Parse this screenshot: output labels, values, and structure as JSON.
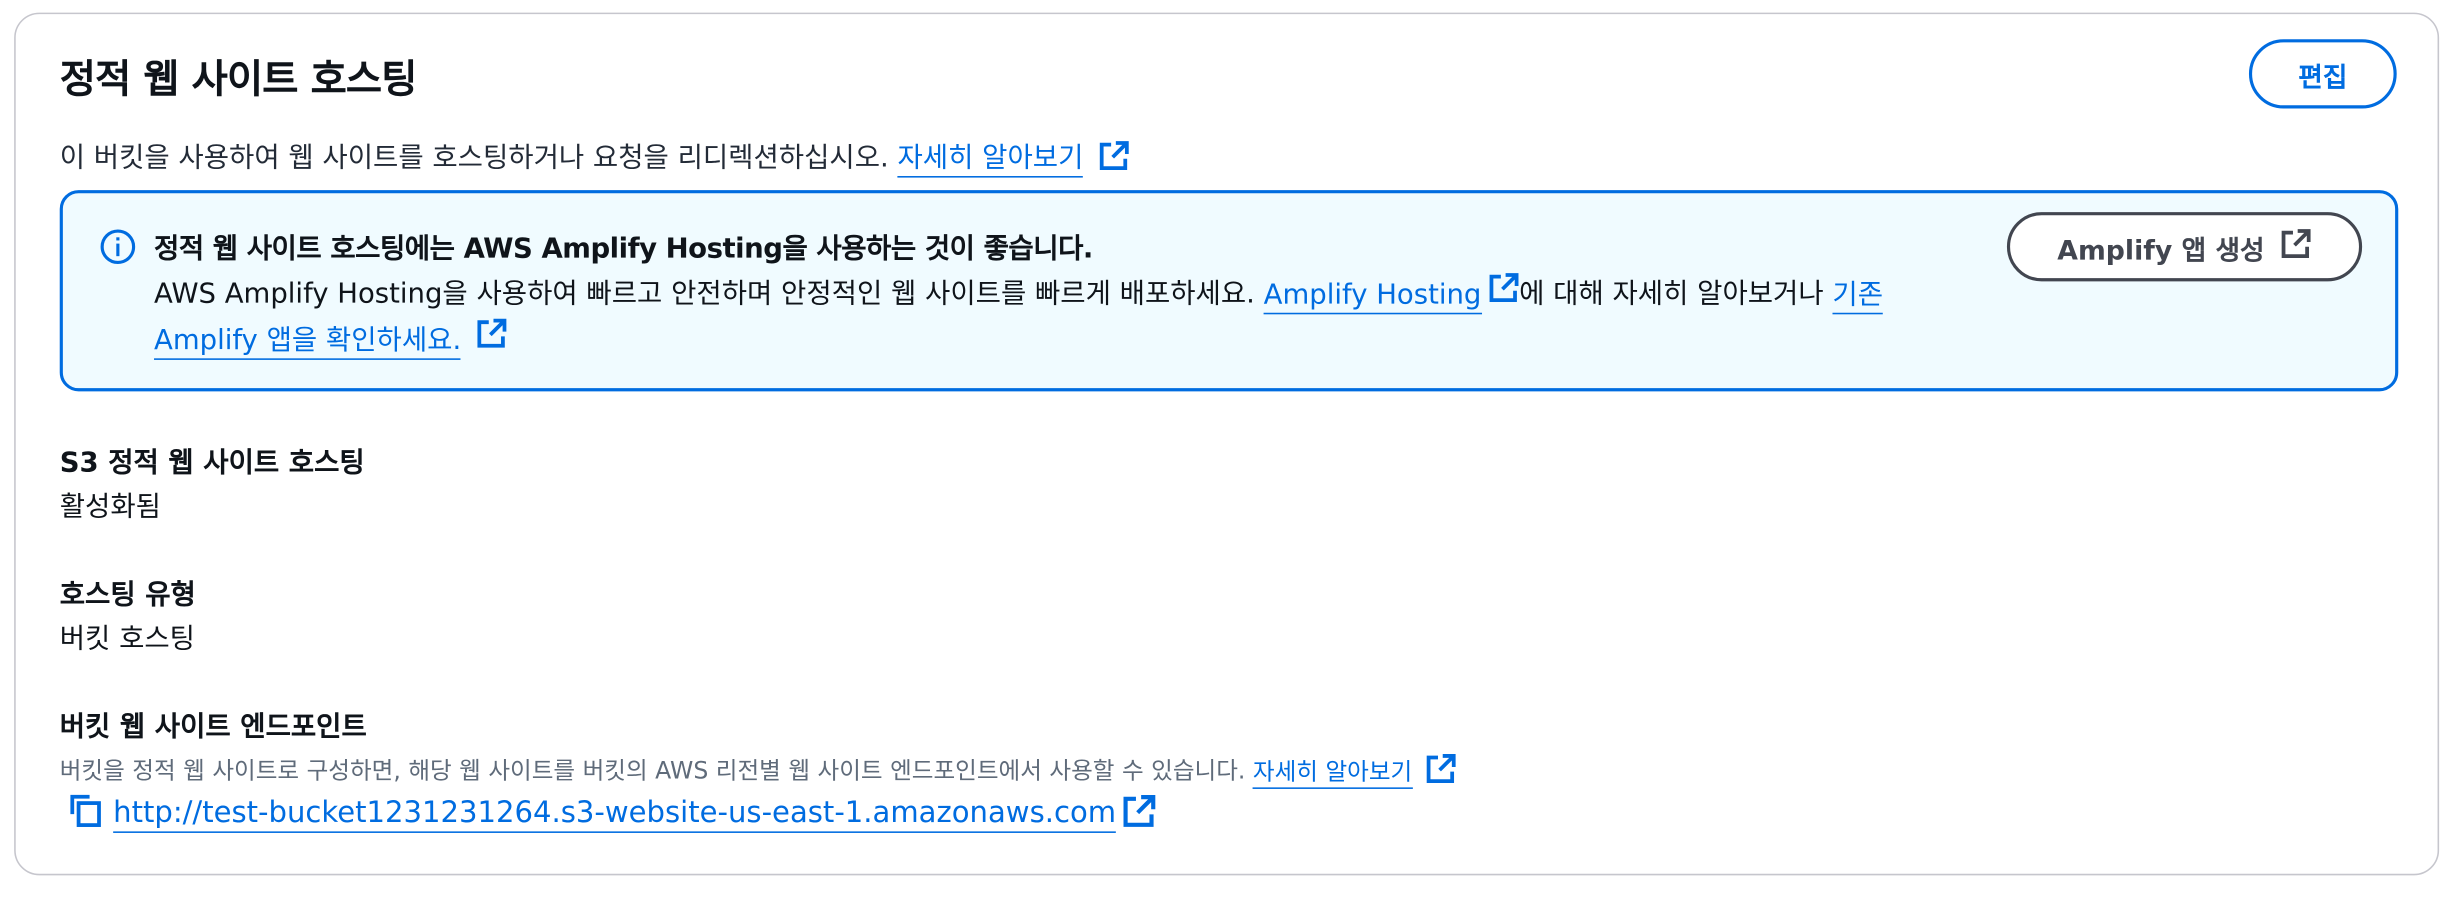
{
  "header": {
    "title": "정적 웹 사이트 호스팅",
    "description": "이 버킷을 사용하여 웹 사이트를 호스팅하거나 요청을 리디렉션하십시오.",
    "learn_more": "자세히 알아보기",
    "edit_label": "편집"
  },
  "alert": {
    "heading": "정적 웹 사이트 호스팅에는 AWS Amplify Hosting을 사용하는 것이 좋습니다.",
    "body_prefix": "AWS Amplify Hosting을 사용하여 빠르고 안전하며 안정적인 웹 사이트를 빠르게 배포하세요.",
    "amplify_link": "Amplify Hosting",
    "body_middle": "에 대해 자세히 알아보거나",
    "existing_link": "기존 Amplify 앱을 확인하세요.",
    "button_label": "Amplify 앱 생성"
  },
  "details": {
    "s3_label": "S3 정적 웹 사이트 호스팅",
    "s3_value": "활성화됨",
    "type_label": "호스팅 유형",
    "type_value": "버킷 호스팅",
    "endpoint_label": "버킷 웹 사이트 엔드포인트",
    "endpoint_hint": "버킷을 정적 웹 사이트로 구성하면, 해당 웹 사이트를 버킷의 AWS 리전별 웹 사이트 엔드포인트에서 사용할 수 있습니다.",
    "endpoint_learn_more": "자세히 알아보기",
    "endpoint_url": "http://test-bucket1231231264.s3-website-us-east-1.amazonaws.com"
  },
  "icons": {
    "external": "external-link-icon",
    "info": "info-icon",
    "copy": "copy-icon"
  },
  "colors": {
    "link": "#006ce0",
    "alert_bg": "#f0fbff",
    "border": "#c6c6cd"
  }
}
